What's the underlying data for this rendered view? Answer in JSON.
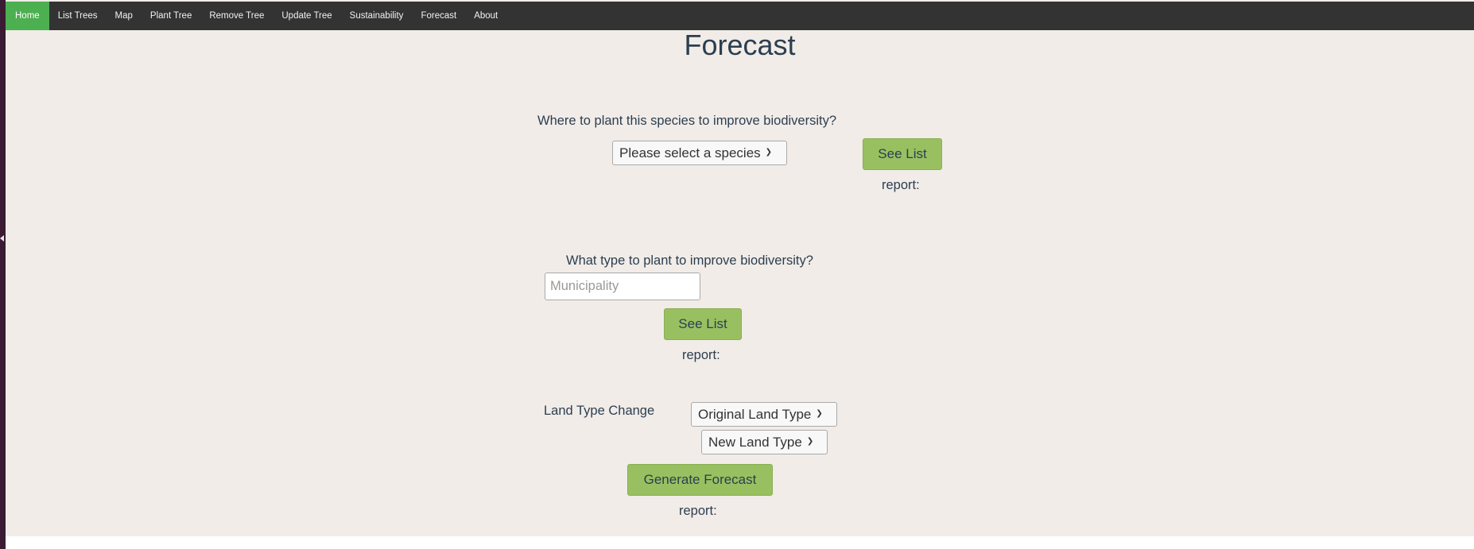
{
  "nav": {
    "items": [
      {
        "label": "Home",
        "active": true
      },
      {
        "label": "List Trees"
      },
      {
        "label": "Map"
      },
      {
        "label": "Plant Tree"
      },
      {
        "label": "Remove Tree"
      },
      {
        "label": "Update Tree"
      },
      {
        "label": "Sustainability"
      },
      {
        "label": "Forecast"
      },
      {
        "label": "About"
      }
    ]
  },
  "page": {
    "title": "Forecast"
  },
  "section1": {
    "question": "Where to plant this species to improve biodiversity?",
    "species_select": "Please select a species",
    "button": "See List",
    "report": "report:"
  },
  "section2": {
    "question": "What type to plant to improve biodiversity?",
    "municipality_placeholder": "Municipality",
    "button": "See List",
    "report": "report:"
  },
  "section3": {
    "label": "Land Type Change",
    "original_select": "Original Land Type",
    "new_select": "New Land Type",
    "button": "Generate Forecast",
    "report": "report:"
  },
  "colors": {
    "navbar": "#333333",
    "nav_active": "#4caf50",
    "page_bg": "#f1ece8",
    "button_green": "#99c060",
    "text": "#2c3e50"
  },
  "icons": [
    "chevron-down-icon",
    "collapse-arrow-icon"
  ]
}
